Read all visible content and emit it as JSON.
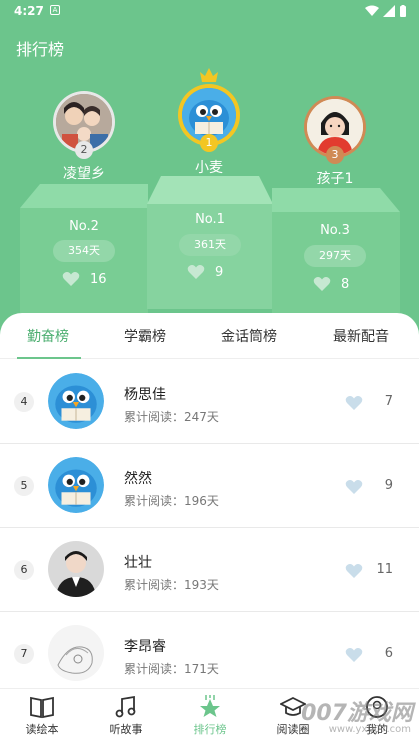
{
  "status_bar": {
    "time": "4:27"
  },
  "header": {
    "title": "排行榜"
  },
  "top_three": [
    {
      "rank": "1",
      "name": "小麦",
      "place": "No.1",
      "days": "361天",
      "likes": "9"
    },
    {
      "rank": "2",
      "name": "凌望乡",
      "place": "No.2",
      "days": "354天",
      "likes": "16"
    },
    {
      "rank": "3",
      "name": "孩子1",
      "place": "No.3",
      "days": "297天",
      "likes": "8"
    }
  ],
  "tabs": [
    {
      "label": "勤奋榜",
      "active": true
    },
    {
      "label": "学霸榜",
      "active": false
    },
    {
      "label": "金话筒榜",
      "active": false
    },
    {
      "label": "最新配音",
      "active": false
    }
  ],
  "list": [
    {
      "rank": "4",
      "name": "杨思佳",
      "read": "累计阅读：247天",
      "likes": "7",
      "avatar": "bird-avatar"
    },
    {
      "rank": "5",
      "name": "然然",
      "read": "累计阅读：196天",
      "likes": "9",
      "avatar": "bird-avatar"
    },
    {
      "rank": "6",
      "name": "壮壮",
      "read": "累计阅读：193天",
      "likes": "11",
      "avatar": "photo-avatar"
    },
    {
      "rank": "7",
      "name": "李昂睿",
      "read": "累计阅读：171天",
      "likes": "6",
      "avatar": "sketch-avatar"
    }
  ],
  "bottom_nav": [
    {
      "label": "读绘本",
      "icon": "book-icon",
      "active": false
    },
    {
      "label": "听故事",
      "icon": "music-note-icon",
      "active": false
    },
    {
      "label": "排行榜",
      "icon": "star-icon",
      "active": true
    },
    {
      "label": "阅读圈",
      "icon": "graduation-cap-icon",
      "active": false
    },
    {
      "label": "我的",
      "icon": "user-icon",
      "active": false
    }
  ],
  "watermark": {
    "main": "007游戏网",
    "sub": "www.yx007.com"
  },
  "colors": {
    "primary": "#6cc58c",
    "podium": "#79cd94",
    "gold": "#f3c623",
    "silver": "#e8e8e8",
    "bronze": "#d08a55"
  }
}
